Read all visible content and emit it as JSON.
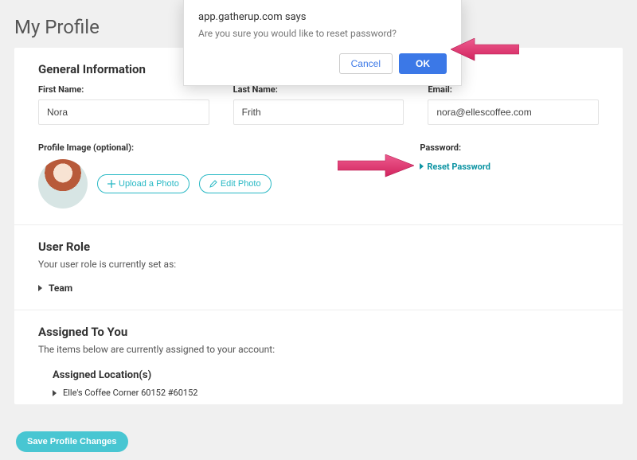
{
  "page_title": "My Profile",
  "general": {
    "heading": "General Information",
    "first_name_label": "First Name:",
    "first_name_value": "Nora",
    "last_name_label": "Last Name:",
    "last_name_value": "Frith",
    "email_label": "Email:",
    "email_value": "nora@ellescoffee.com",
    "profile_image_label": "Profile Image (optional):",
    "upload_photo_label": "Upload a Photo",
    "edit_photo_label": "Edit Photo",
    "password_label": "Password:",
    "reset_password_label": "Reset Password"
  },
  "user_role": {
    "heading": "User Role",
    "description": "Your user role is currently set as:",
    "role": "Team"
  },
  "assigned": {
    "heading": "Assigned To You",
    "description": "The items below are currently assigned to your account:",
    "locations_heading": "Assigned Location(s)",
    "locations": [
      "Elle's Coffee Corner 60152 #60152"
    ]
  },
  "save_label": "Save Profile Changes",
  "dialog": {
    "source": "app.gatherup.com says",
    "message": "Are you sure you would like to reset password?",
    "cancel": "Cancel",
    "ok": "OK"
  },
  "colors": {
    "accent_teal": "#27b8c4",
    "primary_blue": "#3b78e7",
    "arrow_pink": "#e6417a"
  }
}
